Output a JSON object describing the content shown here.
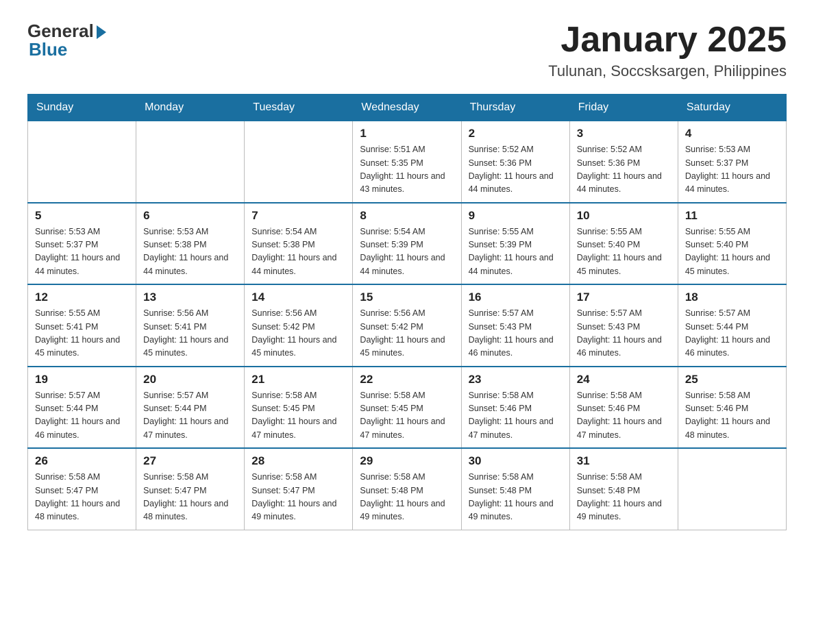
{
  "header": {
    "logo_general": "General",
    "logo_blue": "Blue",
    "month_title": "January 2025",
    "location": "Tulunan, Soccsksargen, Philippines"
  },
  "days_of_week": [
    "Sunday",
    "Monday",
    "Tuesday",
    "Wednesday",
    "Thursday",
    "Friday",
    "Saturday"
  ],
  "weeks": [
    [
      {
        "day": "",
        "info": ""
      },
      {
        "day": "",
        "info": ""
      },
      {
        "day": "",
        "info": ""
      },
      {
        "day": "1",
        "info": "Sunrise: 5:51 AM\nSunset: 5:35 PM\nDaylight: 11 hours\nand 43 minutes."
      },
      {
        "day": "2",
        "info": "Sunrise: 5:52 AM\nSunset: 5:36 PM\nDaylight: 11 hours\nand 44 minutes."
      },
      {
        "day": "3",
        "info": "Sunrise: 5:52 AM\nSunset: 5:36 PM\nDaylight: 11 hours\nand 44 minutes."
      },
      {
        "day": "4",
        "info": "Sunrise: 5:53 AM\nSunset: 5:37 PM\nDaylight: 11 hours\nand 44 minutes."
      }
    ],
    [
      {
        "day": "5",
        "info": "Sunrise: 5:53 AM\nSunset: 5:37 PM\nDaylight: 11 hours\nand 44 minutes."
      },
      {
        "day": "6",
        "info": "Sunrise: 5:53 AM\nSunset: 5:38 PM\nDaylight: 11 hours\nand 44 minutes."
      },
      {
        "day": "7",
        "info": "Sunrise: 5:54 AM\nSunset: 5:38 PM\nDaylight: 11 hours\nand 44 minutes."
      },
      {
        "day": "8",
        "info": "Sunrise: 5:54 AM\nSunset: 5:39 PM\nDaylight: 11 hours\nand 44 minutes."
      },
      {
        "day": "9",
        "info": "Sunrise: 5:55 AM\nSunset: 5:39 PM\nDaylight: 11 hours\nand 44 minutes."
      },
      {
        "day": "10",
        "info": "Sunrise: 5:55 AM\nSunset: 5:40 PM\nDaylight: 11 hours\nand 45 minutes."
      },
      {
        "day": "11",
        "info": "Sunrise: 5:55 AM\nSunset: 5:40 PM\nDaylight: 11 hours\nand 45 minutes."
      }
    ],
    [
      {
        "day": "12",
        "info": "Sunrise: 5:55 AM\nSunset: 5:41 PM\nDaylight: 11 hours\nand 45 minutes."
      },
      {
        "day": "13",
        "info": "Sunrise: 5:56 AM\nSunset: 5:41 PM\nDaylight: 11 hours\nand 45 minutes."
      },
      {
        "day": "14",
        "info": "Sunrise: 5:56 AM\nSunset: 5:42 PM\nDaylight: 11 hours\nand 45 minutes."
      },
      {
        "day": "15",
        "info": "Sunrise: 5:56 AM\nSunset: 5:42 PM\nDaylight: 11 hours\nand 45 minutes."
      },
      {
        "day": "16",
        "info": "Sunrise: 5:57 AM\nSunset: 5:43 PM\nDaylight: 11 hours\nand 46 minutes."
      },
      {
        "day": "17",
        "info": "Sunrise: 5:57 AM\nSunset: 5:43 PM\nDaylight: 11 hours\nand 46 minutes."
      },
      {
        "day": "18",
        "info": "Sunrise: 5:57 AM\nSunset: 5:44 PM\nDaylight: 11 hours\nand 46 minutes."
      }
    ],
    [
      {
        "day": "19",
        "info": "Sunrise: 5:57 AM\nSunset: 5:44 PM\nDaylight: 11 hours\nand 46 minutes."
      },
      {
        "day": "20",
        "info": "Sunrise: 5:57 AM\nSunset: 5:44 PM\nDaylight: 11 hours\nand 47 minutes."
      },
      {
        "day": "21",
        "info": "Sunrise: 5:58 AM\nSunset: 5:45 PM\nDaylight: 11 hours\nand 47 minutes."
      },
      {
        "day": "22",
        "info": "Sunrise: 5:58 AM\nSunset: 5:45 PM\nDaylight: 11 hours\nand 47 minutes."
      },
      {
        "day": "23",
        "info": "Sunrise: 5:58 AM\nSunset: 5:46 PM\nDaylight: 11 hours\nand 47 minutes."
      },
      {
        "day": "24",
        "info": "Sunrise: 5:58 AM\nSunset: 5:46 PM\nDaylight: 11 hours\nand 47 minutes."
      },
      {
        "day": "25",
        "info": "Sunrise: 5:58 AM\nSunset: 5:46 PM\nDaylight: 11 hours\nand 48 minutes."
      }
    ],
    [
      {
        "day": "26",
        "info": "Sunrise: 5:58 AM\nSunset: 5:47 PM\nDaylight: 11 hours\nand 48 minutes."
      },
      {
        "day": "27",
        "info": "Sunrise: 5:58 AM\nSunset: 5:47 PM\nDaylight: 11 hours\nand 48 minutes."
      },
      {
        "day": "28",
        "info": "Sunrise: 5:58 AM\nSunset: 5:47 PM\nDaylight: 11 hours\nand 49 minutes."
      },
      {
        "day": "29",
        "info": "Sunrise: 5:58 AM\nSunset: 5:48 PM\nDaylight: 11 hours\nand 49 minutes."
      },
      {
        "day": "30",
        "info": "Sunrise: 5:58 AM\nSunset: 5:48 PM\nDaylight: 11 hours\nand 49 minutes."
      },
      {
        "day": "31",
        "info": "Sunrise: 5:58 AM\nSunset: 5:48 PM\nDaylight: 11 hours\nand 49 minutes."
      },
      {
        "day": "",
        "info": ""
      }
    ]
  ]
}
